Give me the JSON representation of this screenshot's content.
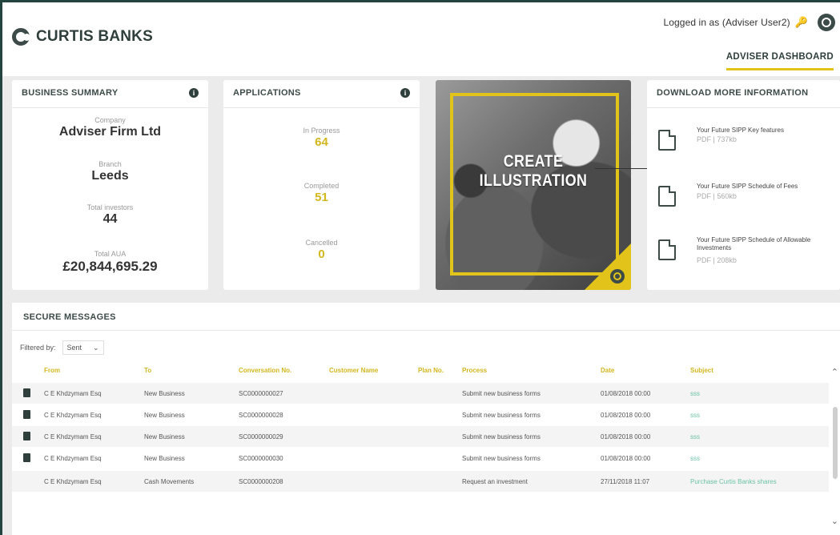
{
  "header": {
    "brand": "CURTIS BANKS",
    "login_text": "Logged in as (Adviser User2)",
    "nav_item": "ADVISER DASHBOARD"
  },
  "business_summary": {
    "title": "BUSINESS SUMMARY",
    "company_label": "Company",
    "company_value": "Adviser Firm Ltd",
    "branch_label": "Branch",
    "branch_value": "Leeds",
    "investors_label": "Total investors",
    "investors_value": "44",
    "aua_label": "Total AUA",
    "aua_value": "£20,844,695.29"
  },
  "applications": {
    "title": "APPLICATIONS",
    "in_progress_label": "In Progress",
    "in_progress_value": "64",
    "completed_label": "Completed",
    "completed_value": "51",
    "cancelled_label": "Cancelled",
    "cancelled_value": "0"
  },
  "illustration": {
    "line1": "CREATE",
    "line2": "ILLUSTRATION"
  },
  "downloads": {
    "title": "DOWNLOAD MORE INFORMATION",
    "items": [
      {
        "title": "Your Future SIPP Key features",
        "meta": "PDF  |  737kb"
      },
      {
        "title": "Your Future SIPP Schedule of Fees",
        "meta": "PDF  |  560kb"
      },
      {
        "title": "Your Future SIPP Schedule of Allowable Investments",
        "meta": "PDF  |  208kb"
      }
    ]
  },
  "messages": {
    "title": "SECURE MESSAGES",
    "filter_label": "Filtered by:",
    "filter_value": "Sent",
    "columns": [
      "From",
      "To",
      "Conversation No.",
      "Customer Name",
      "Plan No.",
      "Process",
      "Date",
      "Subject"
    ],
    "rows": [
      {
        "from": "C E Khdzymam Esq",
        "to": "New Business",
        "conv": "SC0000000027",
        "customer": "",
        "plan": "",
        "process": "Submit new business forms",
        "date": "01/08/2018 00:00",
        "subject": "sss"
      },
      {
        "from": "C E Khdzymam Esq",
        "to": "New Business",
        "conv": "SC0000000028",
        "customer": "",
        "plan": "",
        "process": "Submit new business forms",
        "date": "01/08/2018 00:00",
        "subject": "sss"
      },
      {
        "from": "C E Khdzymam Esq",
        "to": "New Business",
        "conv": "SC0000000029",
        "customer": "",
        "plan": "",
        "process": "Submit new business forms",
        "date": "01/08/2018 00:00",
        "subject": "sss"
      },
      {
        "from": "C E Khdzymam Esq",
        "to": "New Business",
        "conv": "SC0000000030",
        "customer": "",
        "plan": "",
        "process": "Submit new business forms",
        "date": "01/08/2018 00:00",
        "subject": "sss"
      },
      {
        "from": "C E Khdzymam Esq",
        "to": "Cash Movements",
        "conv": "SC0000000208",
        "customer": "",
        "plan": "",
        "process": "Request an investment",
        "date": "27/11/2018 11:07",
        "subject": "Purchase Curtis Banks shares"
      }
    ]
  },
  "colors": {
    "accent": "#e2c319",
    "dark": "#2f3f3c",
    "link": "#6cc2a8"
  }
}
